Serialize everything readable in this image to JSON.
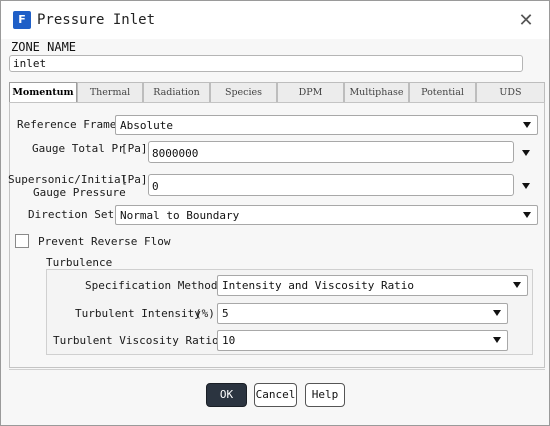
{
  "window": {
    "title": "Pressure Inlet",
    "app_icon_letter": "F"
  },
  "zone": {
    "label": "ZONE NAME",
    "value": "inlet"
  },
  "tabs": [
    {
      "label": "Momentum",
      "active": true
    },
    {
      "label": "Thermal"
    },
    {
      "label": "Radiation"
    },
    {
      "label": "Species"
    },
    {
      "label": "DPM"
    },
    {
      "label": "Multiphase"
    },
    {
      "label": "Potential"
    },
    {
      "label": "UDS"
    }
  ],
  "momentum": {
    "reference_frame": {
      "label": "Reference Frame",
      "value": "Absolute"
    },
    "gauge_total_pressure": {
      "label": "Gauge Total Pr",
      "unit": "[Pa]",
      "value": "8000000"
    },
    "supersonic_pressure": {
      "label_line1": "Supersonic/Initial",
      "label_line2": "Gauge Pressure",
      "unit": "[Pa]",
      "value": "0"
    },
    "direction_set": {
      "label": "Direction Set",
      "value": "Normal to Boundary"
    },
    "prevent_reverse_flow": {
      "label": "Prevent Reverse Flow",
      "checked": false
    }
  },
  "turbulence": {
    "heading": "Turbulence",
    "specification_method": {
      "label": "Specification Method",
      "value": "Intensity and Viscosity Ratio"
    },
    "turbulent_intensity": {
      "label": "Turbulent Intensity",
      "unit": "(%)",
      "value": "5"
    },
    "turbulent_viscosity_ratio": {
      "label": "Turbulent Viscosity Ratio",
      "value": "10"
    }
  },
  "buttons": {
    "ok": "OK",
    "cancel": "Cancel",
    "help": "Help"
  },
  "colors": {
    "brand_icon": "#1f5fc7",
    "ok_button": "#2b3440"
  }
}
